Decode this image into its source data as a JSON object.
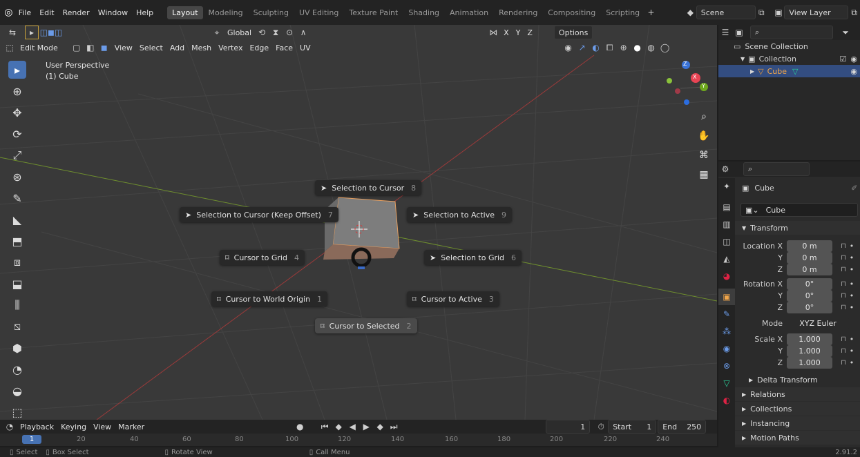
{
  "menu": [
    "File",
    "Edit",
    "Render",
    "Window",
    "Help"
  ],
  "workspaces": [
    "Layout",
    "Modeling",
    "Sculpting",
    "UV Editing",
    "Texture Paint",
    "Shading",
    "Animation",
    "Rendering",
    "Compositing",
    "Scripting"
  ],
  "active_workspace": "Layout",
  "scene": "Scene",
  "view_layer": "View Layer",
  "viewport": {
    "transform_orientation": "Global",
    "axis_x": "X",
    "axis_y": "Y",
    "axis_z": "Z",
    "options": "Options",
    "mode": "Edit Mode",
    "header_menus": [
      "View",
      "Select",
      "Add",
      "Mesh",
      "Vertex",
      "Edge",
      "Face",
      "UV"
    ],
    "overlay_title": "User Perspective",
    "overlay_object": "(1) Cube",
    "gizmo_labels": {
      "x": "X",
      "y": "Y",
      "z": "Z"
    }
  },
  "pie_menu": [
    {
      "id": "sel-to-cursor",
      "label": "Selection to Cursor",
      "num": "8"
    },
    {
      "id": "sel-to-cursor-offset",
      "label": "Selection to Cursor (Keep Offset)",
      "num": "7"
    },
    {
      "id": "sel-to-active",
      "label": "Selection to Active",
      "num": "9"
    },
    {
      "id": "cursor-to-grid",
      "label": "Cursor to Grid",
      "num": "4"
    },
    {
      "id": "sel-to-grid",
      "label": "Selection to Grid",
      "num": "6"
    },
    {
      "id": "cursor-to-origin",
      "label": "Cursor to World Origin",
      "num": "1"
    },
    {
      "id": "cursor-to-active",
      "label": "Cursor to Active",
      "num": "3"
    },
    {
      "id": "cursor-to-selected",
      "label": "Cursor to Selected",
      "num": "2"
    }
  ],
  "outliner": {
    "scene_collection": "Scene Collection",
    "collection": "Collection",
    "object": "Cube"
  },
  "properties": {
    "object_name": "Cube",
    "datablock": "Cube",
    "transform_header": "Transform",
    "location": {
      "label": "Location X",
      "x": "0 m",
      "y": "0 m",
      "z": "0 m"
    },
    "rotation": {
      "label": "Rotation X",
      "x": "0°",
      "y": "0°",
      "z": "0°"
    },
    "mode_label": "Mode",
    "mode_value": "XYZ Euler",
    "scale": {
      "label": "Scale X",
      "x": "1.000",
      "y": "1.000",
      "z": "1.000"
    },
    "axis_y": "Y",
    "axis_z": "Z",
    "sections": [
      "Delta Transform",
      "Relations",
      "Collections",
      "Instancing",
      "Motion Paths"
    ]
  },
  "timeline": {
    "menus": [
      "Playback",
      "Keying",
      "View",
      "Marker"
    ],
    "current_frame": "1",
    "start_label": "Start",
    "start": "1",
    "end_label": "End",
    "end": "250",
    "ruler": [
      "20",
      "40",
      "60",
      "80",
      "100",
      "120",
      "140",
      "160",
      "180",
      "200",
      "220",
      "240"
    ]
  },
  "statusbar": {
    "select": "Select",
    "box_select": "Box Select",
    "rotate_view": "Rotate View",
    "call_menu": "Call Menu",
    "version": "2.91.2"
  }
}
